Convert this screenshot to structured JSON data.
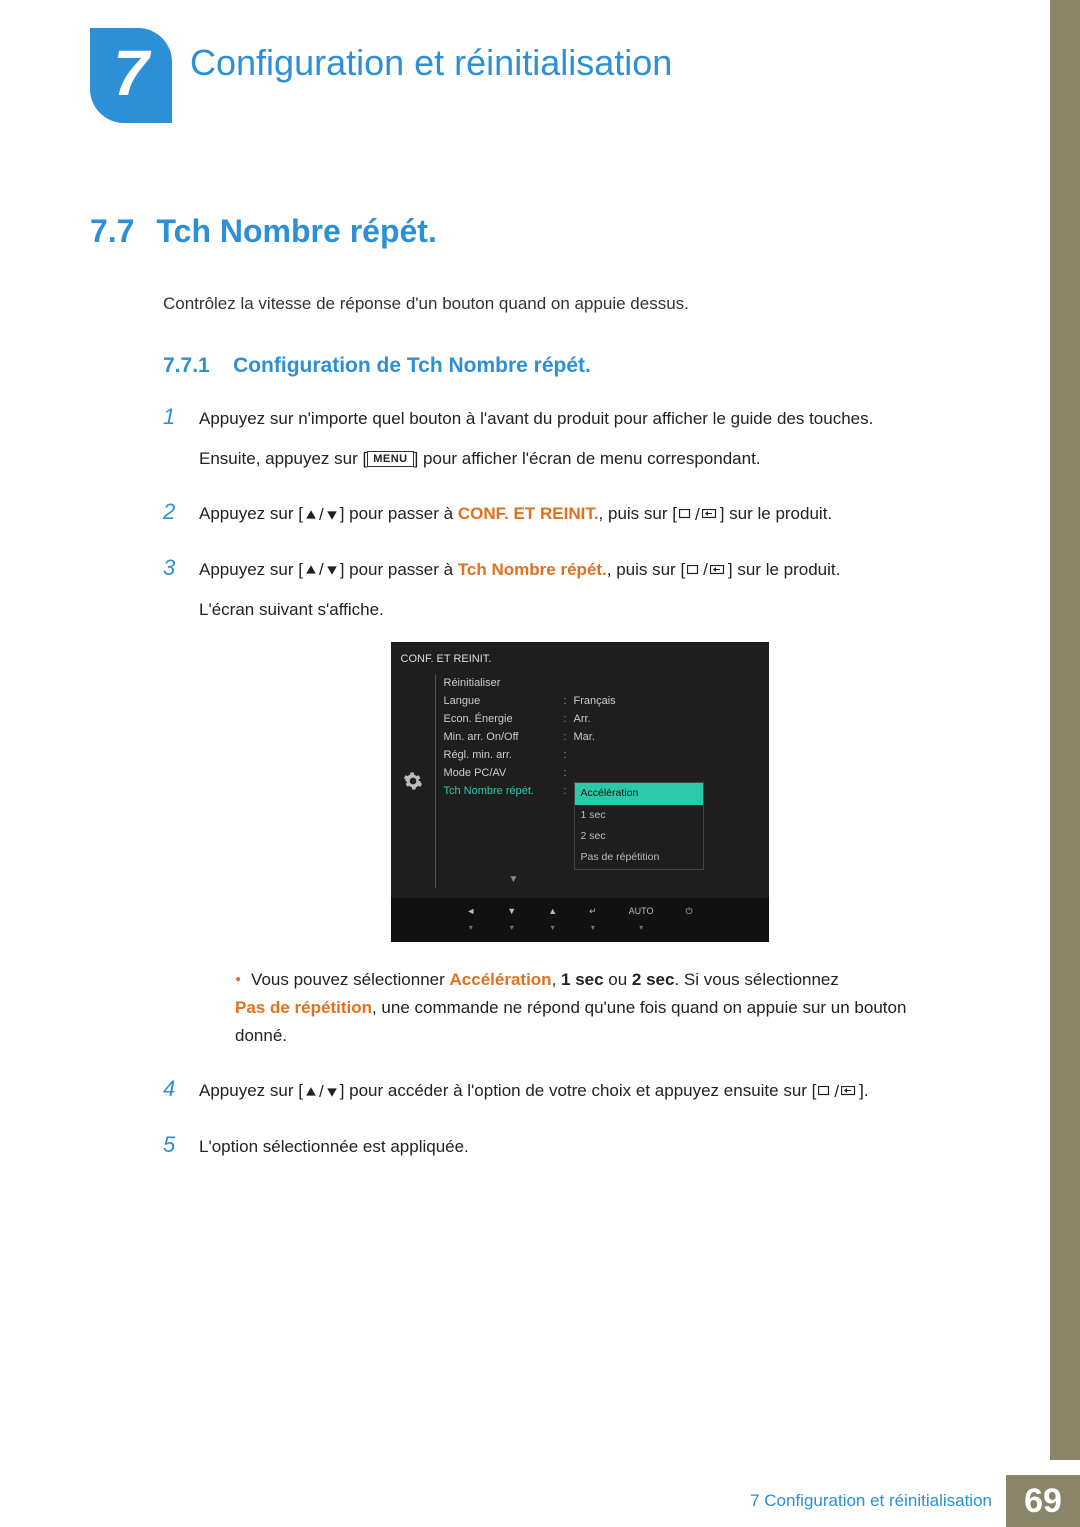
{
  "chapter": {
    "number": "7",
    "title": "Configuration et réinitialisation"
  },
  "section": {
    "number": "7.7",
    "title": "Tch Nombre répét."
  },
  "intro": "Contrôlez la vitesse de réponse d'un bouton quand on appuie dessus.",
  "subsection": {
    "number": "7.7.1",
    "title": "Configuration de Tch Nombre répét."
  },
  "steps": {
    "s1": {
      "num": "1",
      "line1": "Appuyez sur n'importe quel bouton à l'avant du produit pour afficher le guide des touches.",
      "line2_a": "Ensuite, appuyez sur [",
      "menu": "MENU",
      "line2_b": "] pour afficher l'écran de menu correspondant."
    },
    "s2": {
      "num": "2",
      "a": "Appuyez sur [",
      "b": "] pour passer à ",
      "target": "CONF. ET REINIT.",
      "c": ", puis sur [",
      "d": "] sur le produit."
    },
    "s3": {
      "num": "3",
      "a": "Appuyez sur [",
      "b": "] pour passer à ",
      "target": "Tch Nombre répét.",
      "c": ", puis sur [",
      "d": "] sur le produit.",
      "after": "L'écran suivant s'affiche."
    },
    "bullet": {
      "a": "Vous pouvez sélectionner ",
      "acc": "Accélération",
      "comma1": ", ",
      "one": "1 sec",
      "or": " ou ",
      "two": "2 sec",
      "b": ". Si vous sélectionnez ",
      "pas": "Pas de répétition",
      "c": ", une commande ne répond qu'une fois quand on appuie sur un bouton donné."
    },
    "s4": {
      "num": "4",
      "a": "Appuyez sur [",
      "b": "] pour accéder à l'option de votre choix et appuyez ensuite sur [",
      "c": "]."
    },
    "s5": {
      "num": "5",
      "text": "L'option sélectionnée est appliquée."
    }
  },
  "osd": {
    "title": "CONF. ET REINIT.",
    "rows": [
      {
        "label": "Réinitialiser",
        "val": ""
      },
      {
        "label": "Langue",
        "val": "Français"
      },
      {
        "label": "Econ. Énergie",
        "val": "Arr."
      },
      {
        "label": "Min. arr. On/Off",
        "val": "Mar."
      },
      {
        "label": "Régl. min. arr.",
        "val": ""
      },
      {
        "label": "Mode PC/AV",
        "val": ""
      },
      {
        "label": "Tch Nombre répét.",
        "val": ""
      }
    ],
    "options": [
      "Accélération",
      "1 sec",
      "2 sec",
      "Pas de répétition"
    ],
    "bottom": [
      "◄",
      "▼",
      "▲",
      "↵",
      "AUTO",
      "⏻"
    ]
  },
  "footer": {
    "text": "7 Configuration et réinitialisation",
    "page": "69"
  }
}
